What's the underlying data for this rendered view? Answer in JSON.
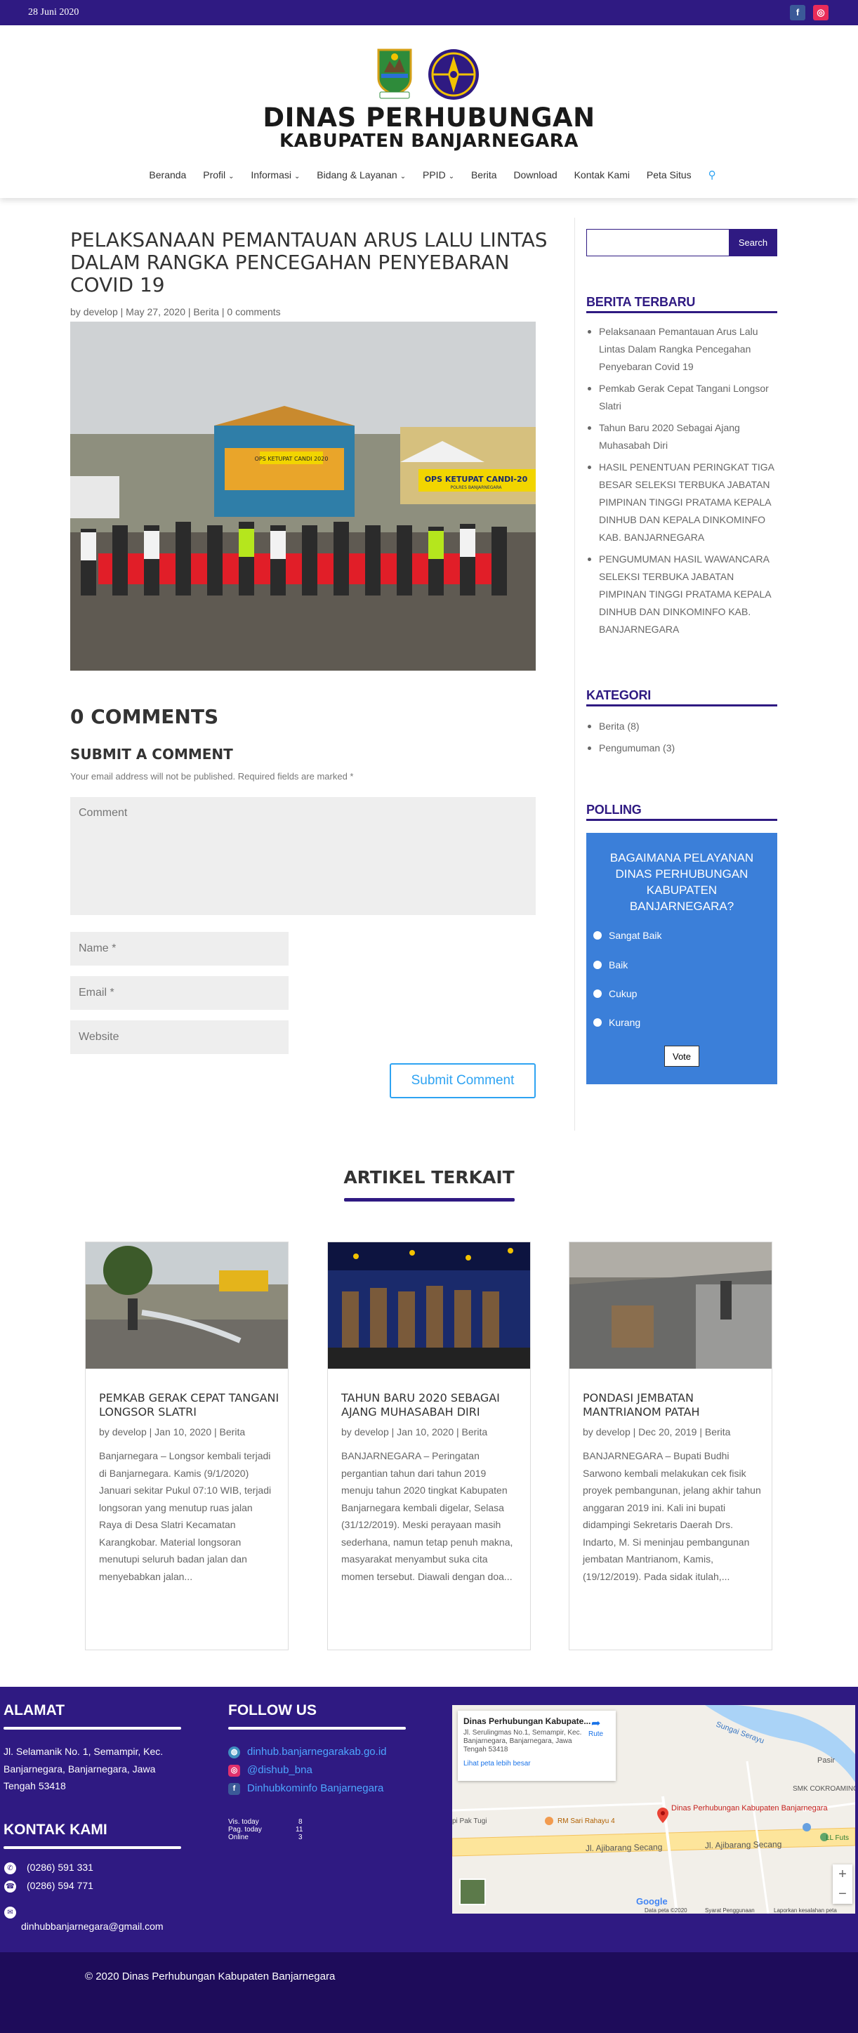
{
  "topbar": {
    "date": "28 Juni 2020",
    "facebook_icon": "f",
    "instagram_icon": "◎"
  },
  "header": {
    "brand_line1": "DINAS PERHUBUNGAN",
    "brand_line2": "KABUPATEN BANJARNEGARA",
    "logo1_caption": "BANJARNEGARA"
  },
  "nav": {
    "items": [
      {
        "label": "Beranda",
        "dropdown": false
      },
      {
        "label": "Profil",
        "dropdown": true
      },
      {
        "label": "Informasi",
        "dropdown": true
      },
      {
        "label": "Bidang & Layanan",
        "dropdown": true
      },
      {
        "label": "PPID",
        "dropdown": true
      },
      {
        "label": "Berita",
        "dropdown": false
      },
      {
        "label": "Download",
        "dropdown": false
      },
      {
        "label": "Kontak Kami",
        "dropdown": false
      },
      {
        "label": "Peta Situs",
        "dropdown": false
      }
    ]
  },
  "post": {
    "title": "PELAKSANAAN PEMANTAUAN ARUS LALU LINTAS DALAM RANGKA PENCEGAHAN PENYEBARAN COVID 19",
    "meta": {
      "by": "by",
      "author": "develop",
      "date": "May 27, 2020",
      "category": "Berita",
      "comments": "0 comments",
      "sep": "|"
    },
    "banner_top": "OPS KETUPAT CANDI 2020",
    "banner_bottom": "OPS KETUPAT CANDI-20",
    "banner_sub": "POLRES BANJARNEGARA"
  },
  "comments": {
    "count_title": "0 COMMENTS",
    "submit_title": "SUBMIT A COMMENT",
    "note": "Your email address will not be published. Required fields are marked *",
    "comment_placeholder": "Comment",
    "name_placeholder": "Name *",
    "email_placeholder": "Email *",
    "website_placeholder": "Website",
    "submit_label": "Submit Comment"
  },
  "sidebar": {
    "search_button": "Search",
    "recent_title": "BERITA TERBARU",
    "recent": [
      "Pelaksanaan Pemantauan Arus Lalu Lintas Dalam Rangka Pencegahan Penyebaran Covid 19",
      "Pemkab Gerak Cepat Tangani Longsor Slatri",
      "Tahun Baru 2020 Sebagai Ajang Muhasabah Diri",
      "HASIL PENENTUAN PERINGKAT TIGA BESAR SELEKSI TERBUKA JABATAN PIMPINAN TINGGI PRATAMA KEPALA DINHUB DAN KEPALA DINKOMINFO KAB. BANJARNEGARA",
      "PENGUMUMAN HASIL WAWANCARA SELEKSI TERBUKA JABATAN PIMPINAN TINGGI PRATAMA KEPALA DINHUB DAN DINKOMINFO KAB. BANJARNEGARA"
    ],
    "category_title": "KATEGORI",
    "categories": [
      "Berita (8)",
      "Pengumuman (3)"
    ],
    "polling_title": "POLLING",
    "poll_question": "BAGAIMANA PELAYANAN DINAS PERHUBUNGAN KABUPATEN BANJARNEGARA?",
    "poll_options": [
      "Sangat Baik",
      "Baik",
      "Cukup",
      "Kurang"
    ],
    "vote_label": "Vote"
  },
  "related": {
    "title": "ARTIKEL TERKAIT",
    "cards": [
      {
        "title": "PEMKAB GERAK CEPAT TANGANI LONGSOR SLATRI",
        "author": "develop",
        "date": "Jan 10, 2020",
        "category": "Berita",
        "excerpt": "Banjarnegara – Longsor kembali terjadi di Banjarnegara. Kamis (9/1/2020) Januari sekitar Pukul 07:10 WIB, terjadi longsoran yang menutup ruas jalan Raya di Desa Slatri Kecamatan Karangkobar. Material longsoran menutupi seluruh badan jalan dan menyebabkan jalan..."
      },
      {
        "title": "TAHUN BARU 2020 SEBAGAI AJANG MUHASABAH DIRI",
        "author": "develop",
        "date": "Jan 10, 2020",
        "category": "Berita",
        "excerpt": "BANJARNEGARA – Peringatan pergantian tahun dari tahun 2019 menuju tahun 2020 tingkat Kabupaten Banjarnegara kembali digelar, Selasa (31/12/2019). Meski perayaan masih sederhana, namun tetap penuh makna, masyarakat menyambut suka cita momen tersebut. Diawali dengan doa..."
      },
      {
        "title": "PONDASI JEMBATAN MANTRIANOM PATAH",
        "author": "develop",
        "date": "Dec 20, 2019",
        "category": "Berita",
        "excerpt": "BANJARNEGARA – Bupati Budhi Sarwono kembali melakukan cek fisik proyek pembangunan, jelang akhir tahun anggaran 2019 ini. Kali ini bupati didampingi Sekretaris Daerah Drs. Indarto, M. Si meninjau pembangunan jembatan Mantrianom, Kamis, (19/12/2019). Pada sidak itulah,..."
      }
    ]
  },
  "footer": {
    "address_title": "ALAMAT",
    "address": "Jl. Selamanik No. 1, Semampir, Kec. Banjarnegara, Banjarnegara, Jawa Tengah 53418",
    "contact_title": "KONTAK KAMI",
    "phone1": "(0286) 591 331",
    "phone2": "(0286) 594 771",
    "email": "dinhubbanjarnegara@gmail.com",
    "follow_title": "FOLLOW US",
    "links": [
      {
        "icon": "globe-icon",
        "text": "dinhub.banjarnegarakab.go.id"
      },
      {
        "icon": "instagram-icon",
        "text": "@dishub_bna"
      },
      {
        "icon": "facebook-icon",
        "text": "Dinhubkominfo Banjarnegara"
      }
    ],
    "stats": [
      {
        "label": "Vis. today",
        "value": "8"
      },
      {
        "label": "Pag. today",
        "value": "11"
      },
      {
        "label": "Online",
        "value": "3"
      }
    ],
    "map": {
      "place_title": "Dinas Perhubungan Kabupate...",
      "place_address": "Jl. Serulingmas No.1, Semampir, Kec. Banjarnegara, Banjarnegara, Jawa Tengah 53418",
      "route": "Rute",
      "bigger_map": "Lihat peta lebih besar",
      "marker_label": "Dinas Perhubungan Kabupaten Banjarnegara",
      "road1": "Jl. Ajibarang Secang",
      "road2": "Jl. Ajibarang Secang",
      "river": "Sungai Serayu",
      "label_pasir": "Pasir",
      "label_smk": "SMK COKROAMINO",
      "label_rm": "RM Sari Rahayu 4",
      "label_tugu": "pi Pak Tugi",
      "label_futs": "LL Futs",
      "google": "Google",
      "data_text": "Data peta ©2020",
      "terms": "Syarat Penggunaan",
      "report": "Laporkan kesalahan peta",
      "zoom_in": "+",
      "zoom_out": "−"
    },
    "copyright": "© 2020 Dinas Perhubungan Kabupaten Banjarnegara"
  }
}
